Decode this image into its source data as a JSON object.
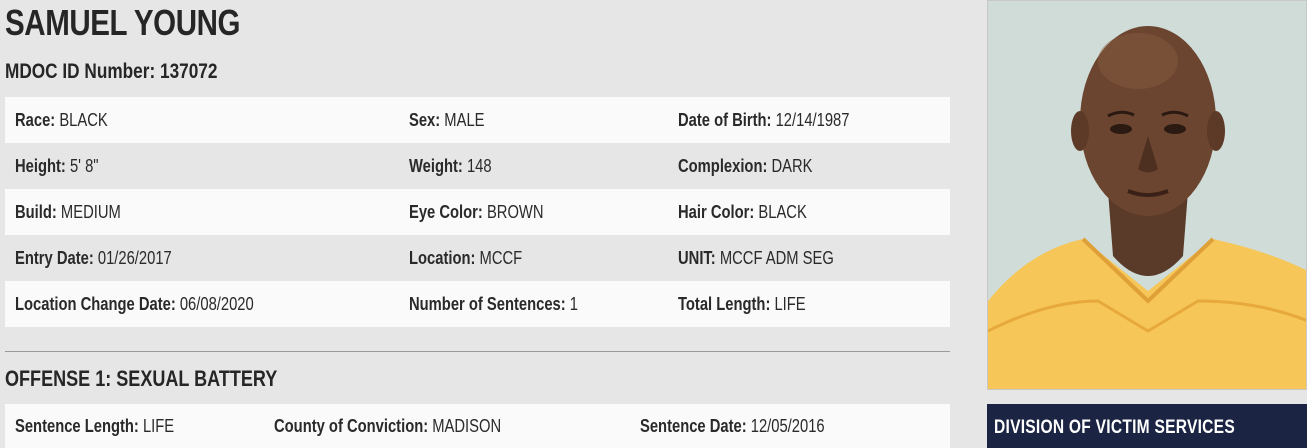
{
  "inmate": {
    "name": "SAMUEL YOUNG",
    "id_label": "MDOC ID Number:",
    "id_value": "137072"
  },
  "details": [
    [
      {
        "label": "Race:",
        "value": "BLACK"
      },
      {
        "label": "Sex:",
        "value": "MALE"
      },
      {
        "label": "Date of Birth:",
        "value": "12/14/1987"
      }
    ],
    [
      {
        "label": "Height:",
        "value": "5' 8\""
      },
      {
        "label": "Weight:",
        "value": "148"
      },
      {
        "label": "Complexion:",
        "value": "DARK"
      }
    ],
    [
      {
        "label": "Build:",
        "value": "MEDIUM"
      },
      {
        "label": "Eye Color:",
        "value": "BROWN"
      },
      {
        "label": "Hair Color:",
        "value": "BLACK"
      }
    ],
    [
      {
        "label": "Entry Date:",
        "value": "01/26/2017"
      },
      {
        "label": "Location:",
        "value": "MCCF"
      },
      {
        "label": "UNIT:",
        "value": "MCCF ADM SEG"
      }
    ],
    [
      {
        "label": "Location Change Date:",
        "value": "06/08/2020"
      },
      {
        "label": "Number of Sentences:",
        "value": "1"
      },
      {
        "label": "Total Length:",
        "value": "LIFE"
      }
    ]
  ],
  "offense": {
    "title": "OFFENSE 1: SEXUAL BATTERY",
    "fields": [
      {
        "label": "Sentence Length:",
        "value": "LIFE"
      },
      {
        "label": "County of Conviction:",
        "value": "MADISON"
      },
      {
        "label": "Sentence Date:",
        "value": "12/05/2016"
      }
    ]
  },
  "sidebar": {
    "victim_services_label": "DIVISION OF VICTIM SERVICES"
  },
  "colors": {
    "page_bg": "#e6e6e6",
    "row_light": "#fafafa",
    "banner_bg": "#1b2442",
    "text": "#262626"
  }
}
